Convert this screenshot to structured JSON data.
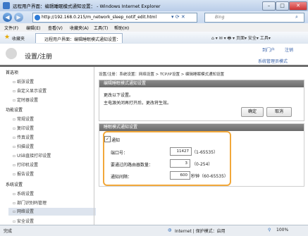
{
  "window": {
    "title": "远程用户界面：编辑睡眠模式通知设置： - Windows Internet Explorer",
    "min": "–",
    "max": "□",
    "close": "✕"
  },
  "addressbar": {
    "url": "http://192.168.0.215/m_network_sleep_notif_edit.html",
    "search_placeholder": "Bing",
    "back": "◀",
    "forward": "▶"
  },
  "menubar": [
    "文件(F)",
    "编辑(E)",
    "查看(V)",
    "收藏夹(A)",
    "工具(T)",
    "帮助(H)"
  ],
  "favbar": {
    "favorites": "收藏夹",
    "tab": "远程用户界面：编辑睡眠模式通知设置："
  },
  "header": {
    "title": "设置/注册",
    "link_portal": "到门户",
    "link_logout": "注销",
    "link_admin": "系统管理员模式"
  },
  "sidebar": {
    "sections": [
      {
        "title": "首选项",
        "items": [
          "纸张设置",
          "自定义显示设置",
          "定时器设置"
        ]
      },
      {
        "title": "功能设置",
        "items": [
          "常规设置",
          "复印设置",
          "传真设置",
          "扫描设置",
          "USB直接打印设置",
          "打印机设置",
          "报告设置"
        ]
      },
      {
        "title": "系统设置",
        "items": [
          "系统设置",
          "部门识别码管理",
          "网络设置",
          "安全设置"
        ]
      }
    ]
  },
  "breadcrumb": "设置/注册：系统设置：网络设置 > TCP/IP设置 > 编辑睡眠模式通知设置",
  "panel1": {
    "title": "编辑睡眠模式通知设置",
    "line1": "更改以下设置。",
    "line2": "主电源关闭再打开后，更改将生效。",
    "ok": "确定",
    "cancel": "取消"
  },
  "panel2": {
    "title": "睡眠模式通知设置",
    "notify_label": "通知",
    "port_label": "端口号：",
    "port_value": "11427",
    "port_range": "（1-65535）",
    "routers_label": "要通过的路由器数量：",
    "routers_value": "3",
    "routers_range": "（0-254）",
    "interval_label": "通知间隔：",
    "interval_value": "600",
    "interval_range": "秒钟（60-65535）"
  },
  "statusbar": {
    "left": "完成",
    "zone": "Internet | 保护模式：启用",
    "zoom": "100%"
  }
}
